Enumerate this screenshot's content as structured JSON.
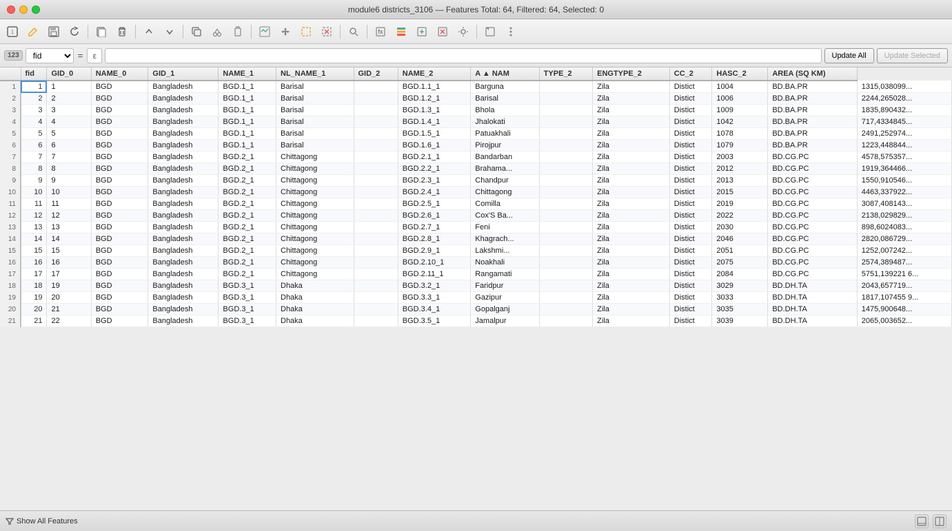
{
  "window": {
    "title": "module6 districts_3106 — Features Total: 64, Filtered: 64, Selected: 0"
  },
  "toolbar": {
    "buttons": [
      {
        "icon": "⊞",
        "name": "toggle-editing",
        "label": "Toggle Editing"
      },
      {
        "icon": "✏️",
        "name": "edit-table",
        "label": "Edit Table"
      },
      {
        "icon": "💾",
        "name": "save",
        "label": "Save"
      },
      {
        "icon": "↩",
        "name": "reload",
        "label": "Reload"
      },
      {
        "icon": "🗓",
        "name": "new-table-window",
        "label": "New Table"
      },
      {
        "icon": "🗑",
        "name": "delete",
        "label": "Delete"
      },
      {
        "icon": "↑",
        "name": "move-selection-up",
        "label": "Move Up"
      },
      {
        "icon": "↓",
        "name": "move-selection-down",
        "label": "Move Down"
      },
      {
        "icon": "📋",
        "name": "copy",
        "label": "Copy"
      },
      {
        "icon": "✂",
        "name": "cut",
        "label": "Cut"
      },
      {
        "icon": "📌",
        "name": "paste",
        "label": "Paste"
      },
      {
        "icon": "🔤",
        "name": "zoom-map-to",
        "label": "Zoom Map"
      },
      {
        "icon": "📐",
        "name": "pan-map",
        "label": "Pan Map"
      },
      {
        "icon": "🔘",
        "name": "select",
        "label": "Select"
      },
      {
        "icon": "⊡",
        "name": "deselect-all",
        "label": "Deselect All"
      },
      {
        "icon": "🔍",
        "name": "search",
        "label": "Search"
      },
      {
        "icon": "🗂",
        "name": "open-field-calc",
        "label": "Field Calculator"
      },
      {
        "icon": "📊",
        "name": "conditional-format",
        "label": "Conditional Format"
      },
      {
        "icon": "📑",
        "name": "new-col",
        "label": "New Column"
      },
      {
        "icon": "📰",
        "name": "delete-col",
        "label": "Delete Column"
      },
      {
        "icon": "🔧",
        "name": "col-settings",
        "label": "Column Settings"
      },
      {
        "icon": "🗺",
        "name": "expand-dock",
        "label": "Expand"
      },
      {
        "icon": "📎",
        "name": "actions",
        "label": "Actions"
      }
    ]
  },
  "filterbar": {
    "type_badge": "123",
    "field_value": "fid",
    "eq_sign": "=",
    "epsilon": "ε",
    "filter_placeholder": "",
    "update_all_label": "Update All",
    "update_selected_label": "Update Selected"
  },
  "table": {
    "columns": [
      "fid",
      "GID_0",
      "NAME_0",
      "GID_1",
      "NAME_1",
      "NL_NAME_1",
      "GID_2",
      "NAME_2",
      "A ▲ NAM",
      "TYPE_2",
      "ENGTYPE_2",
      "CC_2",
      "HASC_2",
      "AREA (SQ KM)"
    ],
    "rows": [
      [
        1,
        1,
        "BGD",
        "Bangladesh",
        "BGD.1_1",
        "Barisal",
        "",
        "BGD.1.1_1",
        "Barguna",
        "",
        "Zila",
        "Distict",
        "1004",
        "BD.BA.PR",
        "1315,038099..."
      ],
      [
        2,
        2,
        "BGD",
        "Bangladesh",
        "BGD.1_1",
        "Barisal",
        "",
        "BGD.1.2_1",
        "Barisal",
        "",
        "Zila",
        "Distict",
        "1006",
        "BD.BA.PR",
        "2244,265028..."
      ],
      [
        3,
        3,
        "BGD",
        "Bangladesh",
        "BGD.1_1",
        "Barisal",
        "",
        "BGD.1.3_1",
        "Bhola",
        "",
        "Zila",
        "Distict",
        "1009",
        "BD.BA.PR",
        "1835,890432..."
      ],
      [
        4,
        4,
        "BGD",
        "Bangladesh",
        "BGD.1_1",
        "Barisal",
        "",
        "BGD.1.4_1",
        "Jhalokati",
        "",
        "Zila",
        "Distict",
        "1042",
        "BD.BA.PR",
        "717,4334845..."
      ],
      [
        5,
        5,
        "BGD",
        "Bangladesh",
        "BGD.1_1",
        "Barisal",
        "",
        "BGD.1.5_1",
        "Patuakhali",
        "",
        "Zila",
        "Distict",
        "1078",
        "BD.BA.PR",
        "2491,252974..."
      ],
      [
        6,
        6,
        "BGD",
        "Bangladesh",
        "BGD.1_1",
        "Barisal",
        "",
        "BGD.1.6_1",
        "Pirojpur",
        "",
        "Zila",
        "Distict",
        "1079",
        "BD.BA.PR",
        "1223,448844..."
      ],
      [
        7,
        7,
        "BGD",
        "Bangladesh",
        "BGD.2_1",
        "Chittagong",
        "",
        "BGD.2.1_1",
        "Bandarban",
        "",
        "Zila",
        "Distict",
        "2003",
        "BD.CG.PC",
        "4578,575357..."
      ],
      [
        8,
        8,
        "BGD",
        "Bangladesh",
        "BGD.2_1",
        "Chittagong",
        "",
        "BGD.2.2_1",
        "Brahama...",
        "",
        "Zila",
        "Distict",
        "2012",
        "BD.CG.PC",
        "1919,364466..."
      ],
      [
        9,
        9,
        "BGD",
        "Bangladesh",
        "BGD.2_1",
        "Chittagong",
        "",
        "BGD.2.3_1",
        "Chandpur",
        "",
        "Zila",
        "Distict",
        "2013",
        "BD.CG.PC",
        "1550,910546..."
      ],
      [
        10,
        10,
        "BGD",
        "Bangladesh",
        "BGD.2_1",
        "Chittagong",
        "",
        "BGD.2.4_1",
        "Chittagong",
        "",
        "Zila",
        "Distict",
        "2015",
        "BD.CG.PC",
        "4463,337922..."
      ],
      [
        11,
        11,
        "BGD",
        "Bangladesh",
        "BGD.2_1",
        "Chittagong",
        "",
        "BGD.2.5_1",
        "Comilla",
        "",
        "Zila",
        "Distict",
        "2019",
        "BD.CG.PC",
        "3087,408143..."
      ],
      [
        12,
        12,
        "BGD",
        "Bangladesh",
        "BGD.2_1",
        "Chittagong",
        "",
        "BGD.2.6_1",
        "Cox'S Ba...",
        "",
        "Zila",
        "Distict",
        "2022",
        "BD.CG.PC",
        "2138,029829..."
      ],
      [
        13,
        13,
        "BGD",
        "Bangladesh",
        "BGD.2_1",
        "Chittagong",
        "",
        "BGD.2.7_1",
        "Feni",
        "",
        "Zila",
        "Distict",
        "2030",
        "BD.CG.PC",
        "898,6024083..."
      ],
      [
        14,
        14,
        "BGD",
        "Bangladesh",
        "BGD.2_1",
        "Chittagong",
        "",
        "BGD.2.8_1",
        "Khagrach...",
        "",
        "Zila",
        "Distict",
        "2046",
        "BD.CG.PC",
        "2820,086729..."
      ],
      [
        15,
        15,
        "BGD",
        "Bangladesh",
        "BGD.2_1",
        "Chittagong",
        "",
        "BGD.2.9_1",
        "Lakshmi...",
        "",
        "Zila",
        "Distict",
        "2051",
        "BD.CG.PC",
        "1252,007242..."
      ],
      [
        16,
        16,
        "BGD",
        "Bangladesh",
        "BGD.2_1",
        "Chittagong",
        "",
        "BGD.2.10_1",
        "Noakhali",
        "",
        "Zila",
        "Distict",
        "2075",
        "BD.CG.PC",
        "2574,389487..."
      ],
      [
        17,
        17,
        "BGD",
        "Bangladesh",
        "BGD.2_1",
        "Chittagong",
        "",
        "BGD.2.11_1",
        "Rangamati",
        "",
        "Zila",
        "Distict",
        "2084",
        "BD.CG.PC",
        "5751,139221 6..."
      ],
      [
        18,
        19,
        "BGD",
        "Bangladesh",
        "BGD.3_1",
        "Dhaka",
        "",
        "BGD.3.2_1",
        "Faridpur",
        "",
        "Zila",
        "Distict",
        "3029",
        "BD.DH.TA",
        "2043,657719..."
      ],
      [
        19,
        20,
        "BGD",
        "Bangladesh",
        "BGD.3_1",
        "Dhaka",
        "",
        "BGD.3.3_1",
        "Gazipur",
        "",
        "Zila",
        "Distict",
        "3033",
        "BD.DH.TA",
        "1817,107455 9..."
      ],
      [
        20,
        21,
        "BGD",
        "Bangladesh",
        "BGD.3_1",
        "Dhaka",
        "",
        "BGD.3.4_1",
        "Gopalganj",
        "",
        "Zila",
        "Distict",
        "3035",
        "BD.DH.TA",
        "1475,900648..."
      ],
      [
        21,
        22,
        "BGD",
        "Bangladesh",
        "BGD.3_1",
        "Dhaka",
        "",
        "BGD.3.5_1",
        "Jamalpur",
        "",
        "Zila",
        "Distict",
        "3039",
        "BD.DH.TA",
        "2065,003652..."
      ]
    ]
  },
  "bottom": {
    "show_features_label": "Show All Features",
    "show_features_icon": "▼"
  }
}
